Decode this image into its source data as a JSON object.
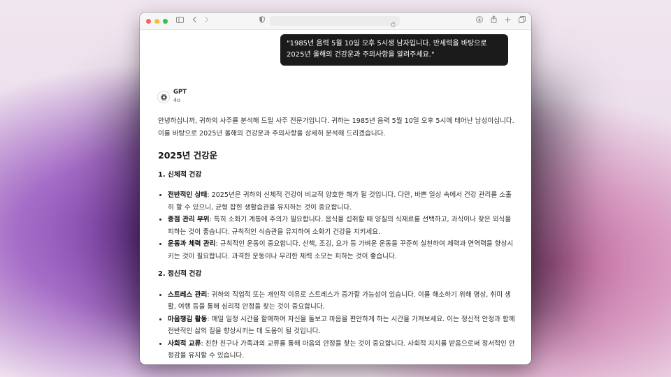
{
  "chat": {
    "user_message": "\"1985년 음력 5월 10일 오후 5시생 남자입니다. 만세력을 바탕으로 2025년 올해의 건강운과 주의사항을 알려주세요.\"",
    "assistant_name": "GPT",
    "assistant_model": "4o",
    "intro": "안녕하십니까, 귀하의 사주를 분석해 드릴 사주 전문가입니다. 귀하는 1985년 음력 5월 10일 오후 5시에 태어난 남성이십니다. 이를 바탕으로 2025년 올해의 건강운과 주의사항을 상세히 분석해 드리겠습니다.",
    "heading": "2025년 건강운",
    "sections": [
      {
        "title": "1. 신체적 건강",
        "items": [
          {
            "label": "전반적인 상태",
            "text": ": 2025년은 귀하의 신체적 건강이 비교적 양호한 해가 될 것입니다. 다만, 바쁜 일상 속에서 건강 관리를 소홀히 할 수 있으니, 균형 잡힌 생활습관을 유지하는 것이 중요합니다."
          },
          {
            "label": "중점 관리 부위",
            "text": ": 특히 소화기 계통에 주의가 필요합니다. 음식을 섭취할 때 양질의 식재료를 선택하고, 과식이나 잦은 외식을 피하는 것이 좋습니다. 규칙적인 식습관을 유지하여 소화기 건강을 지키세요."
          },
          {
            "label": "운동과 체력 관리",
            "text": ": 규칙적인 운동이 중요합니다. 산책, 조깅, 요가 등 가벼운 운동을 꾸준히 실천하여 체력과 면역력을 향상시키는 것이 필요합니다. 과격한 운동이나 무리한 체력 소모는 피하는 것이 좋습니다."
          }
        ]
      },
      {
        "title": "2. 정신적 건강",
        "items": [
          {
            "label": "스트레스 관리",
            "text": ": 귀하의 직업적 또는 개인적 이유로 스트레스가 증가할 가능성이 있습니다. 이를 해소하기 위해 명상, 취미 생활, 여행 등을 통해 심리적 안정을 찾는 것이 중요합니다."
          },
          {
            "label": "마음챙김 활동",
            "text": ": 매일 일정 시간을 할애하여 자신을 돌보고 마음을 편안하게 하는 시간을 가져보세요. 이는 정신적 안정과 함께 전반적인 삶의 질을 향상시키는 데 도움이 될 것입니다."
          },
          {
            "label": "사회적 교류",
            "text": ": 친한 친구나 가족과의 교류를 통해 마음의 안정을 찾는 것이 중요합니다. 사회적 지지를 받음으로써 정서적인 안정감을 유지할 수 있습니다."
          }
        ]
      }
    ]
  },
  "icons": [
    "sidebar-icon",
    "back-icon",
    "forward-icon",
    "shield-icon",
    "reload-icon",
    "download-icon",
    "share-icon",
    "new-tab-icon",
    "tabs-icon",
    "openai-logo-icon"
  ],
  "colors": {
    "user_bubble": "#1b1b1b",
    "close": "#fe5f57",
    "minimize": "#febc2e",
    "zoom": "#28c840"
  }
}
